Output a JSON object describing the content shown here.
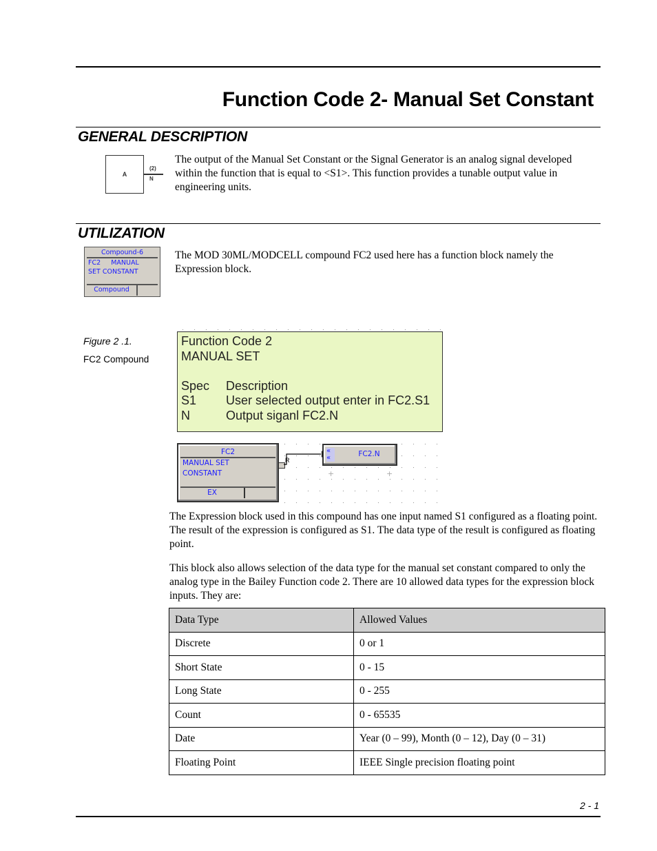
{
  "page": {
    "title": "Function Code 2- Manual Set Constant",
    "page_number": "2 - 1"
  },
  "general_description": {
    "heading": "GENERAL DESCRIPTION",
    "symbol": {
      "label": "A",
      "output_number": "(2)",
      "output_name": "N"
    },
    "text": "The output of the Manual Set Constant or the Signal Generator is an analog signal developed within the function that is equal to <S1>. This function provides a tunable output value in engineering units."
  },
  "utilization": {
    "heading": "UTILIZATION",
    "compound_icon": {
      "header": "Compound-6",
      "line1": "FC2     MANUAL",
      "line2": "SET CONSTANT",
      "footer": "Compound"
    },
    "text": "The MOD 30ML/MODCELL compound FC2 used here has a function block namely the Expression block."
  },
  "figure": {
    "caption": "Figure 2 .1.",
    "subcaption": "FC2 Compound",
    "description_box": {
      "line1": "Function Code 2",
      "line2": "MANUAL SET",
      "rows": [
        {
          "spec": "Spec",
          "description": "Description"
        },
        {
          "spec": "S1",
          "description": "User selected output enter in FC2.S1"
        },
        {
          "spec": "N",
          "description": "Output siganl FC2.N"
        }
      ]
    },
    "block": {
      "header": "FC2",
      "line1": "MANUAL SET",
      "line2": "CONSTANT",
      "footer": "EX",
      "port_label": "R"
    },
    "output_tag": {
      "arrow_glyph": "«",
      "label": "FC2.N"
    },
    "accent_color": "#1a1aff",
    "box_color": "#eaf7c4"
  },
  "body": {
    "para1": "The Expression block used in this compound has one input named S1 configured as a floating point. The result of the expression is configured as S1. The data type of the result is configured as floating point.",
    "para2": "This block also allows selection of the data type for the manual set constant compared to only the analog type in the Bailey Function code 2. There are 10 allowed data types for the expression block inputs. They are:"
  },
  "table": {
    "headers": [
      "Data Type",
      "Allowed Values"
    ],
    "rows": [
      [
        "Discrete",
        "0 or 1"
      ],
      [
        "Short State",
        "0 - 15"
      ],
      [
        "Long State",
        "0 - 255"
      ],
      [
        "Count",
        "0 - 65535"
      ],
      [
        "Date",
        "Year (0 – 99), Month (0 – 12), Day (0 – 31)"
      ],
      [
        "Floating Point",
        "IEEE Single precision floating point"
      ]
    ]
  }
}
